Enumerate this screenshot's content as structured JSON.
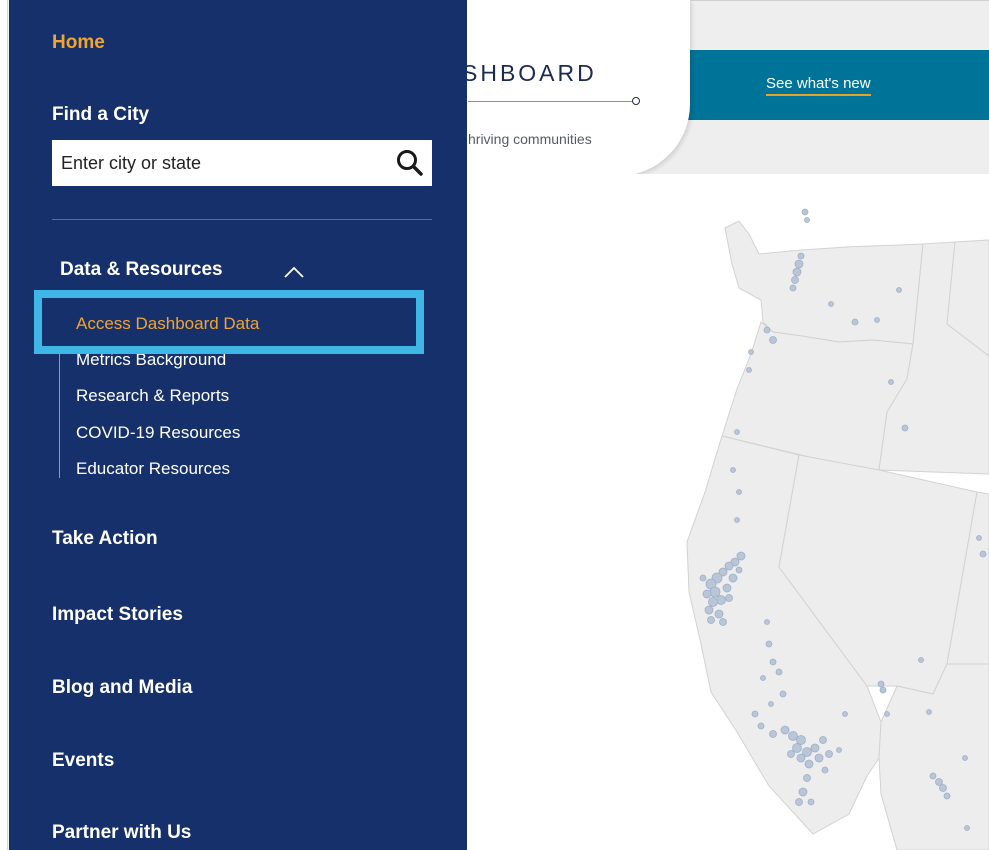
{
  "header": {
    "logo_text": "SHBOARD",
    "logo_tagline": "hriving communities",
    "whats_new_link": "See what's new"
  },
  "sidebar": {
    "home": "Home",
    "find_city": {
      "label": "Find a City",
      "placeholder": "Enter city or state"
    },
    "data_resources": {
      "label": "Data & Resources",
      "items": [
        "Access Dashboard Data",
        "Metrics Background",
        "Research & Reports",
        "COVID-19 Resources",
        "Educator Resources"
      ]
    },
    "nav_items": [
      "Take Action",
      "Impact Stories",
      "Blog and Media",
      "Events",
      "Partner with Us"
    ]
  },
  "colors": {
    "sidebar_bg": "#16306b",
    "accent_orange": "#f0a530",
    "teal_bar": "#007398",
    "highlight_blue": "#3fb6e6"
  }
}
